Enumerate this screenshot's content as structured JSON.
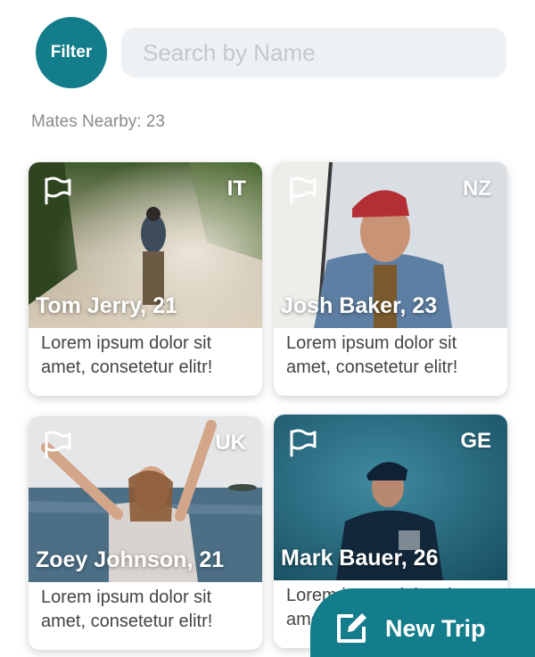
{
  "header": {
    "filter_label": "Filter",
    "search_placeholder": "Search by Name"
  },
  "nearby_text": "Mates Nearby: 23",
  "cards": [
    {
      "name": "Tom Jerry, 21",
      "country": "IT",
      "description": "Lorem ipsum dolor sit amet, consetetur elitr!"
    },
    {
      "name": "Josh Baker, 23",
      "country": "NZ",
      "description": "Lorem ipsum dolor sit amet, consetetur elitr!"
    },
    {
      "name": "Zoey Johnson, 21",
      "country": "UK",
      "description": "Lorem ipsum dolor sit amet, consetetur elitr!"
    },
    {
      "name": "Mark Bauer, 26",
      "country": "GE",
      "description": "Lorem ipsum dolor sit amet, consetetur elitr!"
    }
  ],
  "fab": {
    "label": "New Trip",
    "icon": "edit-icon"
  },
  "colors": {
    "accent": "#137d8b",
    "search_bg": "#eef1f3"
  }
}
